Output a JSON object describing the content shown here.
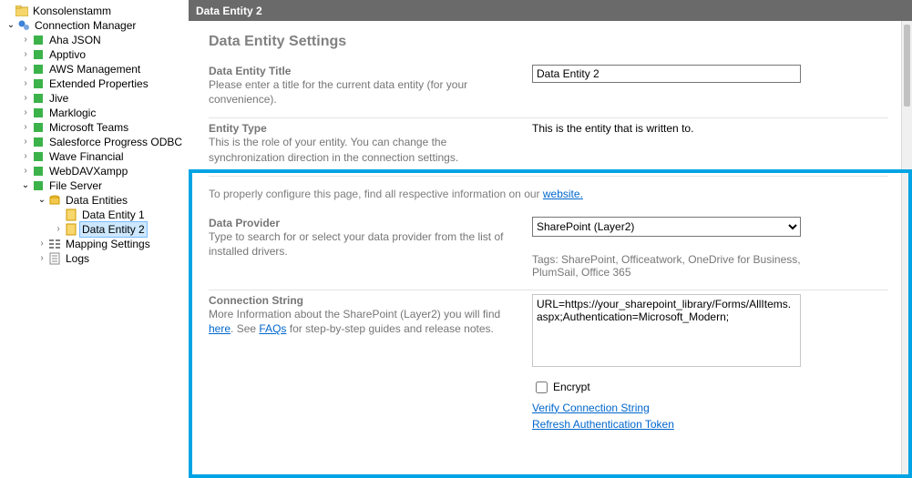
{
  "tree": {
    "root_label": "Konsolenstamm",
    "conn_mgr": "Connection Manager",
    "items": [
      "Aha JSON",
      "Apptivo",
      "AWS Management",
      "Extended Properties",
      "Jive",
      "Marklogic",
      "Microsoft Teams",
      "Salesforce Progress ODBC",
      "Wave Financial",
      "WebDAVXampp"
    ],
    "file_server": "File Server",
    "data_entities": "Data Entities",
    "data_entity_1": "Data Entity 1",
    "data_entity_2": "Data Entity 2",
    "mapping_settings": "Mapping Settings",
    "logs": "Logs"
  },
  "header": {
    "title": "Data Entity 2"
  },
  "section": {
    "title": "Data Entity Settings"
  },
  "entity_title": {
    "label": "Data Entity Title",
    "desc": "Please enter a title for the current data entity (for your convenience).",
    "value": "Data Entity 2"
  },
  "entity_type": {
    "label": "Entity Type",
    "desc": "This is the role of your entity. You can change the synchronization direction in the connection settings.",
    "value": "This is the entity that is written to."
  },
  "info_line": {
    "prefix": "To properly configure this page, find all respective information on our ",
    "link": "website.",
    "suffix": ""
  },
  "provider": {
    "label": "Data Provider",
    "desc": "Type to search for or select your data provider from the list of installed drivers.",
    "value": "SharePoint (Layer2)",
    "tags": "Tags: SharePoint, Officeatwork, OneDrive for Business, PlumSail, Office 365"
  },
  "connstr": {
    "label": "Connection String",
    "desc_pre": "More Information about the SharePoint (Layer2) you will find ",
    "link1": "here",
    "desc_mid": ". See ",
    "link2": "FAQs",
    "desc_post": " for step-by-step guides and release notes.",
    "value": "URL=https://your_sharepoint_library/Forms/AllItems.aspx;Authentication=Microsoft_Modern;",
    "encrypt_label": "Encrypt",
    "verify_link": "Verify Connection String",
    "refresh_link": "Refresh Authentication Token"
  }
}
